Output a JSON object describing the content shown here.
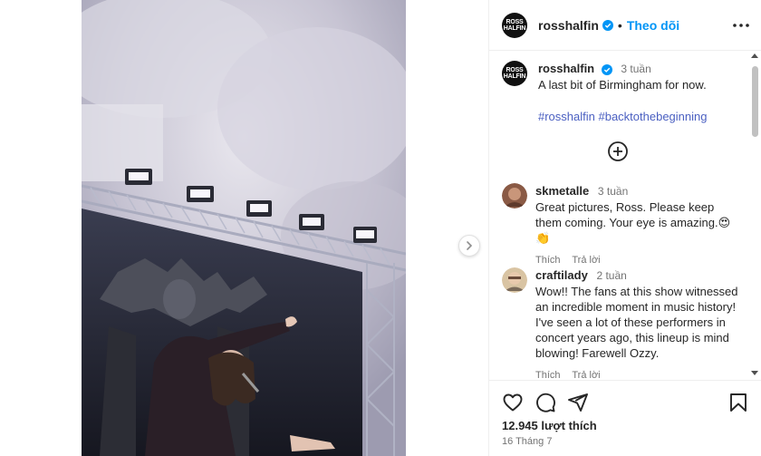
{
  "post": {
    "author": "rosshalfin",
    "follow_label": "Theo dõi",
    "avatar_logo": "ROSS HALFIN",
    "caption": {
      "time": "3 tuần",
      "text": "A last bit of Birmingham for now.",
      "hashtags": "#rosshalfin #backtothebeginning"
    },
    "likes": "12.945 lượt thích",
    "date": "16 Tháng 7"
  },
  "comments": [
    {
      "username": "skmetalle",
      "time": "3 tuần",
      "text": "Great pictures, Ross. Please keep them coming. Your eye is amazing.😍👏",
      "like_label": "Thích",
      "reply_label": "Trả lời"
    },
    {
      "username": "craftilady",
      "time": "2 tuần",
      "text": "Wow!! The fans at this show witnessed an incredible moment in music history! I've seen a lot of these performers in concert years ago, this lineup is mind blowing! Farewell Ozzy.",
      "like_label": "Thích",
      "reply_label": "Trả lời"
    }
  ],
  "icons": {
    "verified": "verified-badge-icon",
    "more": "more-options-icon",
    "add": "add-circle-icon",
    "like": "heart-icon",
    "comment": "comment-icon",
    "share": "share-icon",
    "save": "bookmark-icon",
    "next": "chevron-right-icon"
  },
  "colors": {
    "accent": "#0095f6",
    "hashtag": "#4a5fc1",
    "verified": "#0095f6",
    "muted": "#737373"
  }
}
